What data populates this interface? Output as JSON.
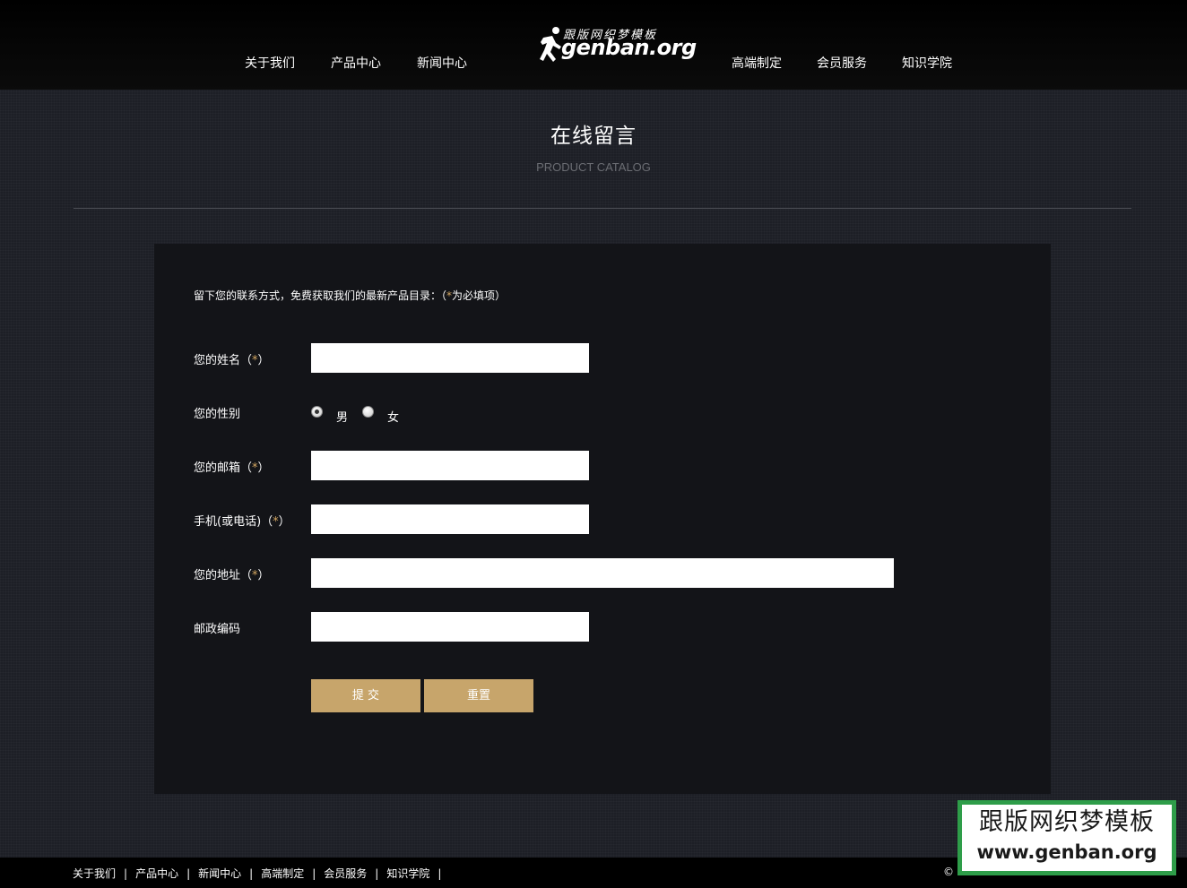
{
  "header": {
    "nav_left": [
      "关于我们",
      "产品中心",
      "新闻中心"
    ],
    "nav_right": [
      "高端制定",
      "会员服务",
      "知识学院"
    ],
    "logo": {
      "cn": "跟版网织梦模板",
      "en": "genban.org"
    }
  },
  "page": {
    "title": "在线留言",
    "subtitle": "PRODUCT CATALOG"
  },
  "form": {
    "intro_prefix": "留下您的联系方式，免费获取我们的最新产品目录：（",
    "intro_star": "*",
    "intro_suffix": "为必填项）",
    "required_open": "（",
    "required_star": "*",
    "required_close": "）",
    "name_label": "您的姓名",
    "gender_label": "您的性别",
    "gender_options": [
      "男",
      "女"
    ],
    "gender_selected": "男",
    "email_label": "您的邮箱",
    "phone_label": "手机(或电话)",
    "address_label": "您的地址",
    "zip_label": "邮政编码",
    "name_value": "",
    "email_value": "",
    "phone_value": "",
    "address_value": "",
    "zip_value": "",
    "submit_label": "提 交",
    "reset_label": "重置"
  },
  "footer": {
    "links": [
      "关于我们",
      "产品中心",
      "新闻中心",
      "高端制定",
      "会员服务",
      "知识学院"
    ],
    "separator": "|",
    "copyright": "© 2"
  },
  "watermark": {
    "cn": "跟版网织梦模板",
    "en": "www.genban.org"
  },
  "colors": {
    "accent": "#c7a56b",
    "star": "#d4a762",
    "panel": "#131418",
    "watermark_green": "#2e9d49"
  }
}
